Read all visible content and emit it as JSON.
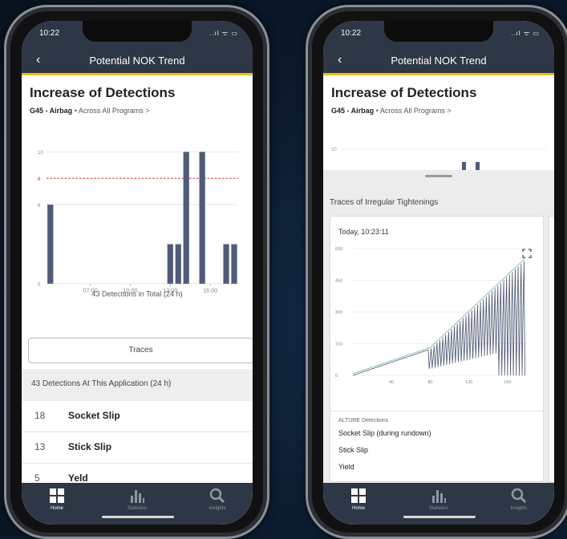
{
  "status": {
    "time": "10:22",
    "indicators": "..ıl ᯤ ▭"
  },
  "nav": {
    "title": "Potential NOK Trend",
    "back_icon": "chevron-left-icon"
  },
  "header": {
    "title": "Increase of Detections",
    "part": "G45 - Airbag",
    "separator": "•",
    "scope": "Across All Programs",
    "scope_chevron": ">"
  },
  "chart_data": {
    "type": "bar",
    "x_tick_labels": [
      "07:00",
      "10:00",
      "13:00",
      "16:00"
    ],
    "y_tick_labels": [
      "0",
      "6",
      "8",
      "10"
    ],
    "threshold": {
      "value": 8,
      "label": "8",
      "color": "#d9343a"
    },
    "bars": [
      {
        "slot": 0,
        "value": 6
      },
      {
        "slot": 15,
        "value": 3
      },
      {
        "slot": 16,
        "value": 3
      },
      {
        "slot": 17,
        "value": 10
      },
      {
        "slot": 19,
        "value": 10
      },
      {
        "slot": 22,
        "value": 3
      },
      {
        "slot": 23,
        "value": 3
      }
    ],
    "ylim": [
      0,
      10
    ],
    "bar_color": "#4f5b78",
    "footer": "43 Detections in Total (24 h)"
  },
  "traces_button": "Traces",
  "section": {
    "title": "43 Detections At This Application (24 h)"
  },
  "detections": [
    {
      "count": "18",
      "label": "Socket Slip"
    },
    {
      "count": "13",
      "label": "Stick Slip"
    },
    {
      "count": "5",
      "label": "Yeld"
    }
  ],
  "tabs": [
    {
      "label": "Home",
      "icon": "grid-icon"
    },
    {
      "label": "Statistics",
      "icon": "bar-chart-icon"
    },
    {
      "label": "Insights",
      "icon": "search-icon"
    }
  ],
  "right_phone": {
    "mini_chart_tick": "10",
    "sheet_title": "Traces of Irregular Tightenings",
    "card": {
      "timestamp": "Today, 10:23:11",
      "y_ticks": [
        "0",
        "150",
        "300",
        "450",
        "600"
      ],
      "x_ticks": [
        "40",
        "80",
        "120",
        "160"
      ],
      "detections_heading": "ALTURE Detections",
      "detections": [
        "Socket Slip (during rundown)",
        "Stick Slip",
        "Yield"
      ]
    }
  },
  "colors": {
    "navy": "#2e3745",
    "accent": "#e8c20a",
    "bar": "#4f5b78",
    "trace_dark": "#4b5670",
    "trace_light": "#7fc4b8"
  }
}
